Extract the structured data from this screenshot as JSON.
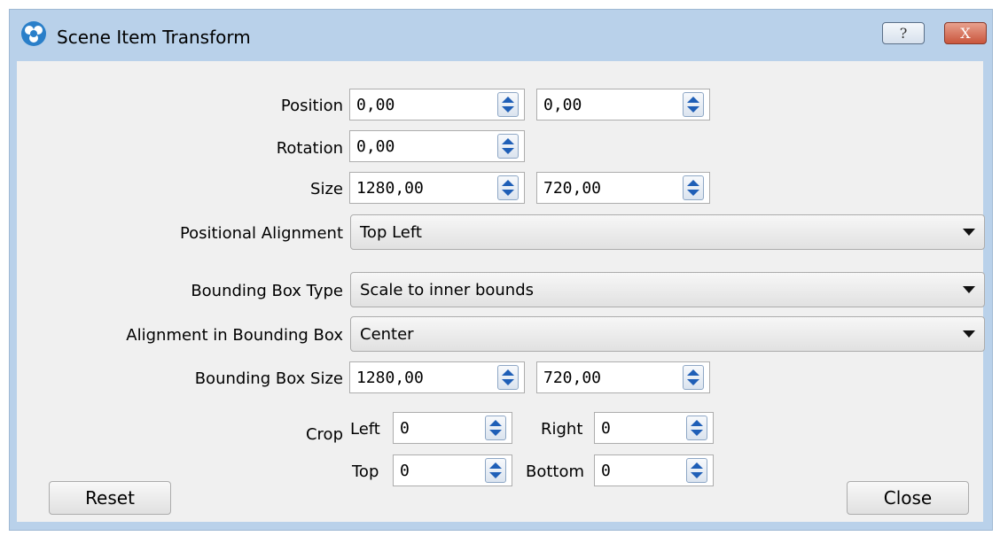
{
  "window": {
    "title": "Scene Item Transform",
    "help_label": "?",
    "close_label": "X"
  },
  "position": {
    "label": "Position",
    "x": "0,00",
    "y": "0,00"
  },
  "rotation": {
    "label": "Rotation",
    "value": "0,00"
  },
  "size": {
    "label": "Size",
    "width": "1280,00",
    "height": "720,00"
  },
  "positional_alignment": {
    "label": "Positional Alignment",
    "value": "Top Left"
  },
  "bounding_box_type": {
    "label": "Bounding Box Type",
    "value": "Scale to inner bounds"
  },
  "alignment_in_bounding_box": {
    "label": "Alignment in Bounding Box",
    "value": "Center"
  },
  "bounding_box_size": {
    "label": "Bounding Box Size",
    "width": "1280,00",
    "height": "720,00"
  },
  "crop": {
    "label": "Crop",
    "left_label": "Left",
    "left": "0",
    "right_label": "Right",
    "right": "0",
    "top_label": "Top",
    "top": "0",
    "bottom_label": "Bottom",
    "bottom": "0"
  },
  "buttons": {
    "reset": "Reset",
    "close": "Close"
  },
  "colors": {
    "titlebar": "#b9d1ea",
    "client": "#f0f0f0",
    "spin_arrow": "#1f5fb7"
  },
  "icons": {
    "app": "obs-logo-icon",
    "spin": "spin-arrows-icon",
    "dropdown": "dropdown-caret-icon"
  }
}
